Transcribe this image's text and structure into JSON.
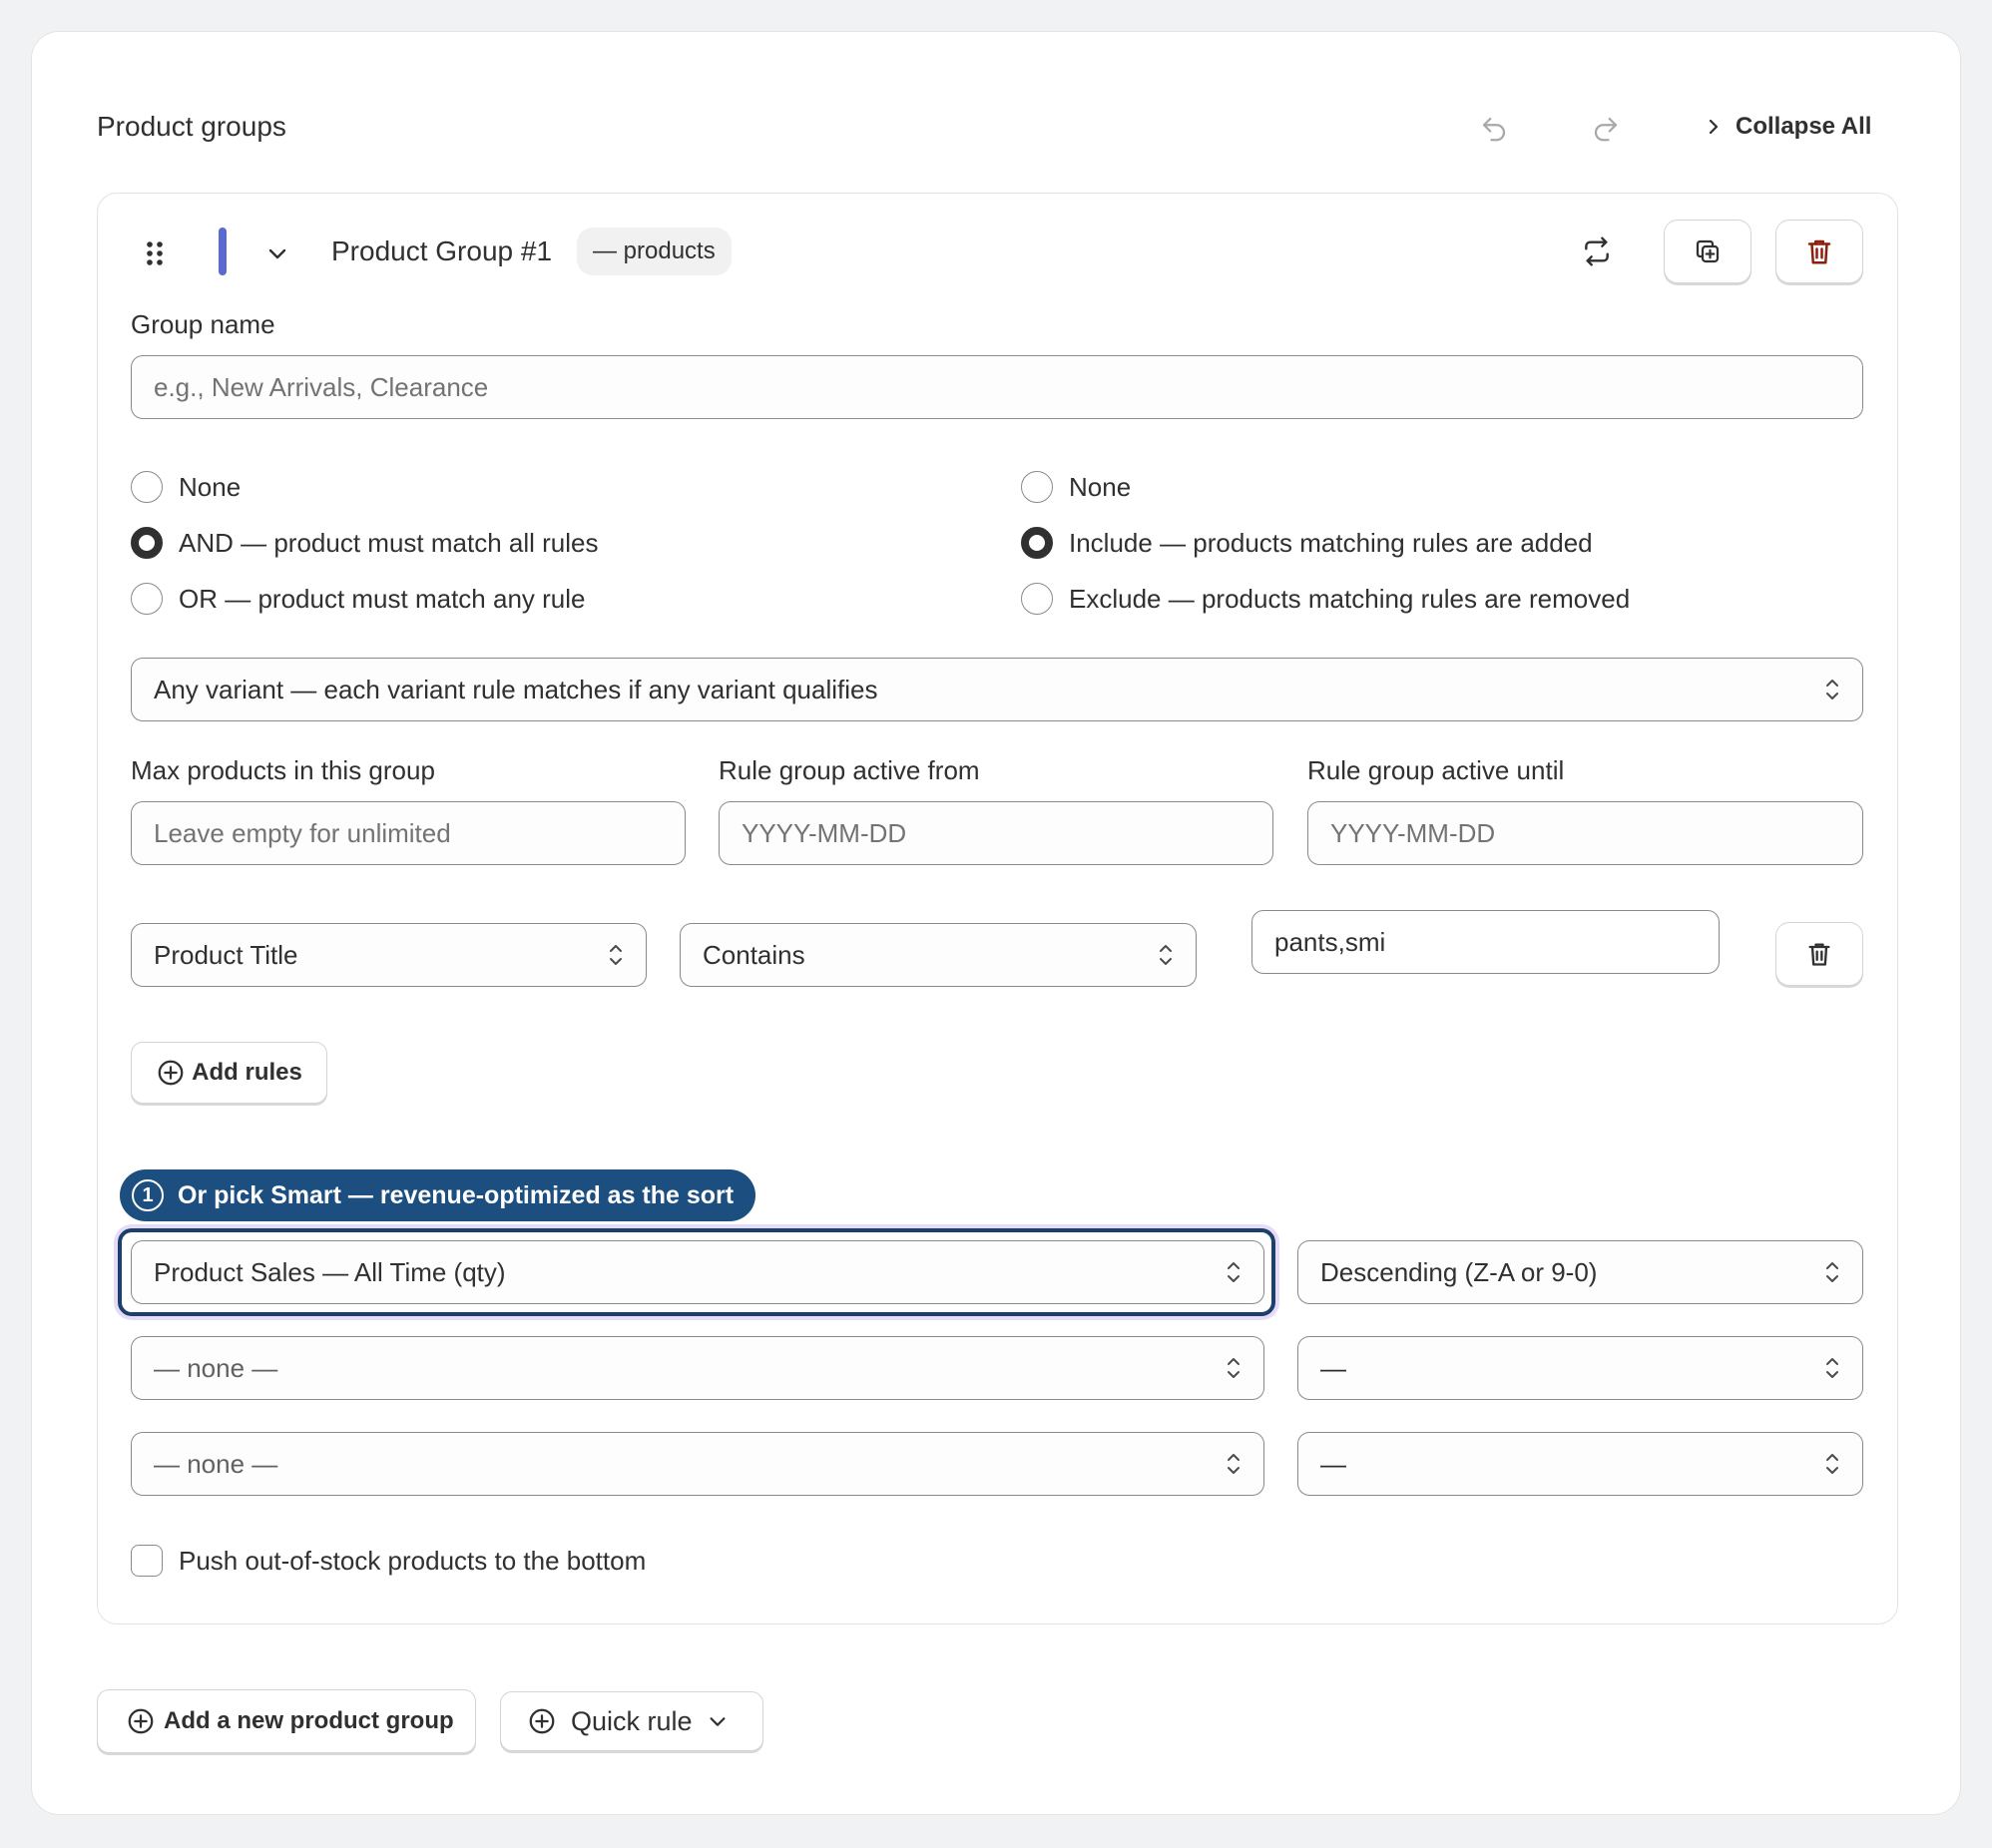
{
  "header": {
    "title": "Product groups",
    "collapse_label": "Collapse All"
  },
  "group": {
    "title": "Product Group #1",
    "count_badge": "— products",
    "accent_color": "#5b6acf",
    "name_label": "Group name",
    "name_value": "",
    "name_placeholder": "e.g., New Arrivals, Clearance",
    "match_options": [
      {
        "label": "None",
        "selected": false
      },
      {
        "label": "AND — product must match all rules",
        "selected": true
      },
      {
        "label": "OR — product must match any rule",
        "selected": false
      }
    ],
    "mode_options": [
      {
        "label": "None",
        "selected": false
      },
      {
        "label": "Include — products matching rules are added",
        "selected": true
      },
      {
        "label": "Exclude — products matching rules are removed",
        "selected": false
      }
    ],
    "variant_select": "Any variant — each variant rule matches if any variant qualifies",
    "max_products_label": "Max products in this group",
    "max_products_placeholder": "Leave empty for unlimited",
    "active_from_label": "Rule group active from",
    "active_from_placeholder": "YYYY-MM-DD",
    "active_until_label": "Rule group active until",
    "active_until_placeholder": "YYYY-MM-DD",
    "rule": {
      "field": "Product Title",
      "operator": "Contains",
      "value": "pants,smi"
    },
    "add_rules_label": "Add rules",
    "tour": {
      "step": "1",
      "text": "Or pick Smart — revenue-optimized as the sort",
      "color": "#1c4f80"
    },
    "sorts": [
      {
        "field": "Product Sales — All Time (qty)",
        "direction": "Descending (Z-A or 9-0)"
      },
      {
        "field": "— none —",
        "direction": "—"
      },
      {
        "field": "— none —",
        "direction": "—"
      }
    ],
    "push_oos_label": "Push out-of-stock products to the bottom",
    "push_oos_checked": false
  },
  "footer": {
    "add_group_label": "Add a new product group",
    "quick_rule_label": "Quick rule"
  },
  "colors": {
    "delete_red": "#8e1f0b",
    "text": "#303030"
  }
}
